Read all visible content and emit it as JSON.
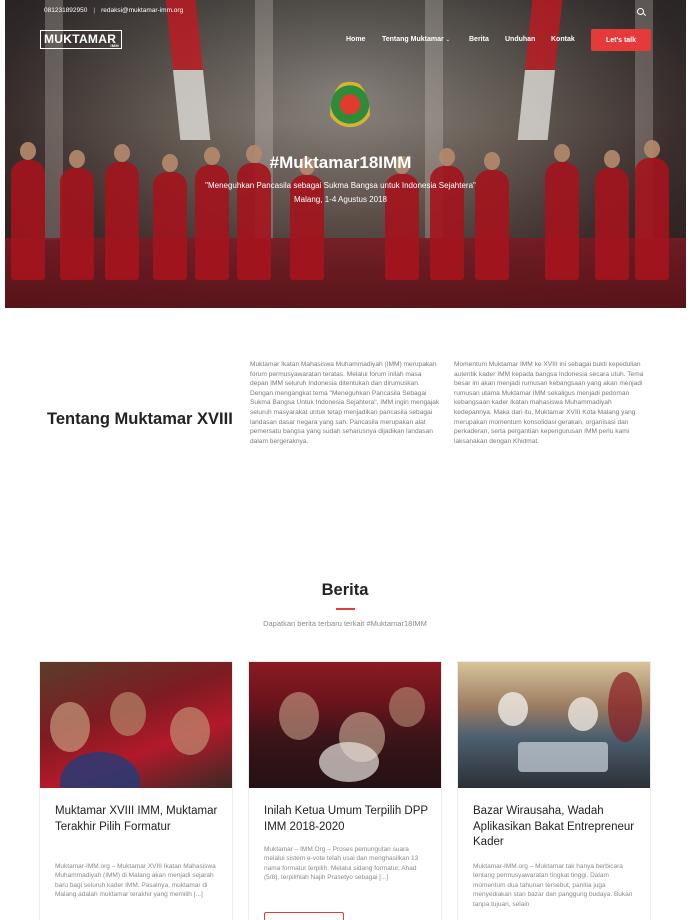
{
  "topbar": {
    "phone": "081231892950",
    "email": "redaksi@muktamar-imm.org",
    "separator": "|"
  },
  "brand": {
    "logo_text": "MUKTAMAR",
    "logo_sub": "IMM"
  },
  "nav": {
    "items": [
      {
        "label": "Home"
      },
      {
        "label": "Tentang Muktamar",
        "has_dropdown": true
      },
      {
        "label": "Berita"
      },
      {
        "label": "Unduhan"
      },
      {
        "label": "Kontak"
      }
    ],
    "cta_label": "Let's talk"
  },
  "hero": {
    "title": "#Muktamar18IMM",
    "subtitle": "\"Meneguhkan Pancasila sebagai Sukma Bangsa untuk Indonesia Sejahtera\"",
    "date": "Malang, 1-4 Agustus 2018"
  },
  "about": {
    "title": "Tentang Muktamar XVIII",
    "col1": "Muktamar Ikatan Mahasiswa Muhammadiyah (IMM) merupakan forum permusyawaratan teratas. Melalui forum inilah masa depan IMM seluruh Indonesia ditentukan dan dirumuskan. Dengan mengangkat tema \"Meneguhkan Pancasila Sebagai Sukma Bangsa Untuk Indonesia Sejahtera\", IMM ingin mengajak seluruh masyarakat untuk tetap menjadikan pancasila sebagai landasan dasar negara yang sah. Pancasila merupakan alat pemersatu bangsa yang sudah seharusnya dijadikan landasan dalam bergeraknya.",
    "col2": "Momentum Muktamar IMM ke XVIII ini sebagai bukti kepedulian autentik kader IMM kepada bangsa Indonesia secara utuh. Tema besar ini akan menjadi rumusan kebangsaan yang akan menjadi rumusan utama Muktamar IMM sekaligus menjadi pedoman kebangsaan kader Ikatan mahasiswa Muhammadiyah kedepannya. Maka dari itu, Muktamar XVIII Kota Malang yang merupakan momentum konsolidasi gerakan, organisasi dan perkaderan, serta pergantian kepengurusan IMM perlu kami laksanakan dengan Khidmat."
  },
  "news": {
    "title": "Berita",
    "subtitle": "Dapatkan berita terbaru terkait #Muktamar18IMM",
    "cards": [
      {
        "title": "Muktamar XVIII IMM, Muktamar Terakhir Pilih Formatur",
        "excerpt": "Muktamar-IMM.org – Muktamar XVIII Ikatan Mahasiswa Muhammadiyah (IMM) di Malang akan menjadi sejarah baru bagi seluruh kader IMM. Pasalnya, muktamar di Malang adalah muktamar terakhir yang memilih [...]"
      },
      {
        "title": "Inilah Ketua Umum Terpilih DPP IMM 2018-2020",
        "excerpt": "Muktamar – IMM.Org – Proses pemungutan suara melalui sistem e-vote telah usai dan menghasilkan 13 nama formatur terpilih. Melalui sidang formatur, Ahad (5/8), terpilihlah Najih Prasetyo sebagai [...]",
        "button": ""
      },
      {
        "title": "Bazar Wirausaha, Wadah Aplikasikan Bakat Entrepreneur Kader",
        "excerpt": "Muktamar-IMM.org – Muktamar tak hanya berbicara tentang permusyawaratan tingkat tinggi. Dalam momentum dua tahunan tersebut, panitia juga menyediakan stan bazar dan panggung budaya. Bukan tanpa tujuan, selain"
      }
    ]
  },
  "colors": {
    "accent": "#e53a3a",
    "heading": "#222222",
    "body_text": "#7a7a7a"
  }
}
